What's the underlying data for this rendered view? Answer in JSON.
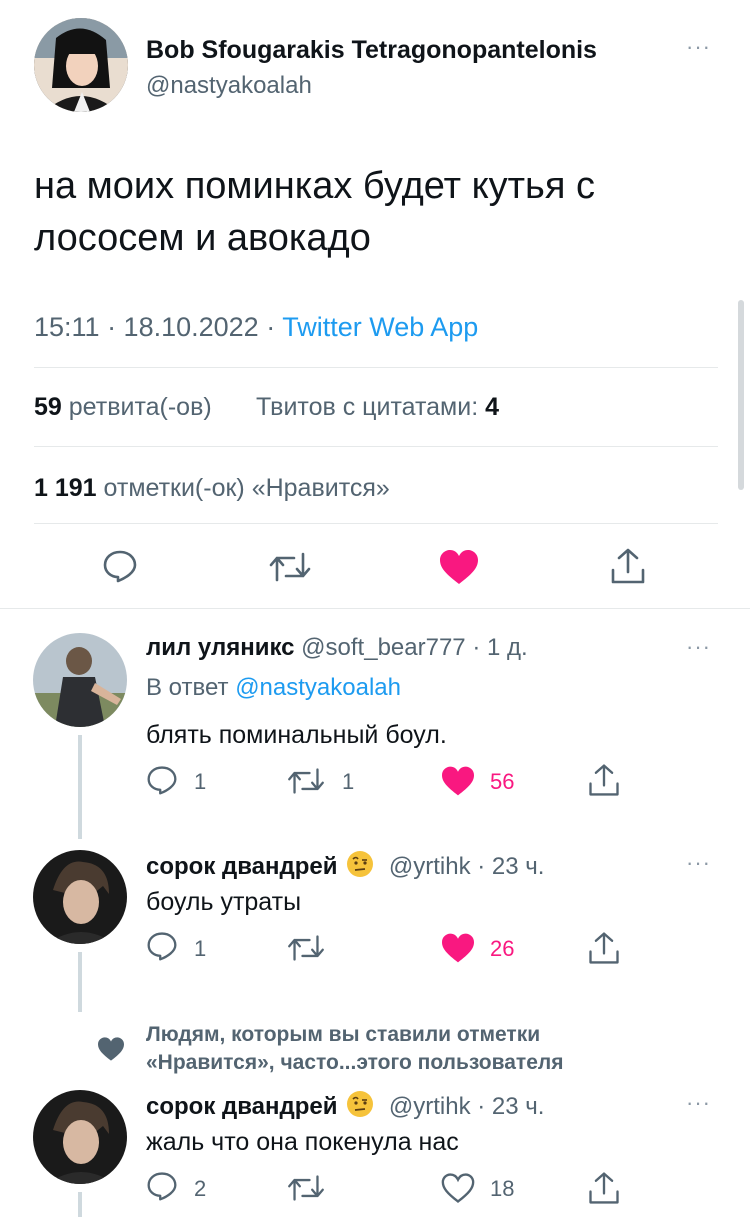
{
  "tweet": {
    "author_name": "Bob Sfougarakis Tetragonopantelonis",
    "author_handle": "@nastyakoalah",
    "text_line1": "на моих поминках будет кутья с",
    "text_line2": "лососем и авокадо",
    "time": "15:11 · 18.10.2022 · ",
    "source": "Twitter Web App",
    "retweets_count": "59",
    "retweets_label": "ретвита(-ов)",
    "quotes_label": "Твитов с цитатами:",
    "quotes_count": "4",
    "likes_count": "1 191",
    "likes_label": "отметки(-ок) «Нравится»"
  },
  "replies": [
    {
      "name": "лил уляникс",
      "handle": "@soft_bear777 · 1 д.",
      "reply_to_prefix": "В ответ ",
      "reply_to": "@nastyakoalah",
      "text": "блять поминальный боул.",
      "replies": "1",
      "retweets": "1",
      "likes": "56",
      "liked": true
    },
    {
      "name": "сорок двандрей",
      "handle": "@yrtihk · 23 ч.",
      "text": "боуль утраты",
      "replies": "1",
      "retweets": "",
      "likes": "26",
      "liked": true
    },
    {
      "name": "сорок двандрей",
      "handle": "@yrtihk · 23 ч.",
      "text": "жаль что она покенула нас",
      "replies": "2",
      "retweets": "",
      "likes": "18",
      "liked": false
    }
  ],
  "social_context": {
    "line1": "Людям, которым вы ставили отметки",
    "line2": "«Нравится», часто...этого пользователя"
  },
  "colors": {
    "like": "#f91880",
    "link": "#1d9bf0",
    "secondary_text": "#536471"
  }
}
